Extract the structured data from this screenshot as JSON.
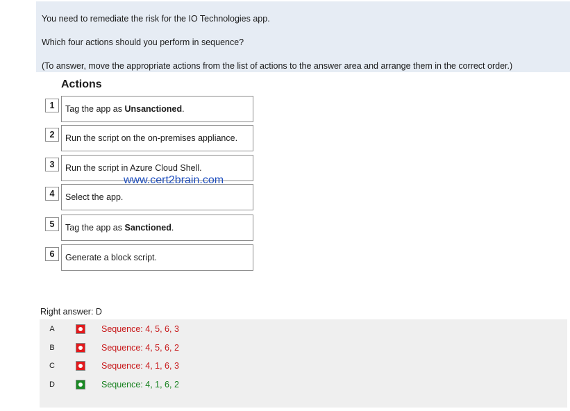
{
  "question": {
    "line1": "You need to remediate the risk for the IO Technologies app.",
    "line2": "Which four actions should you perform in sequence?",
    "line3": "(To answer, move the appropriate actions from the list of actions to the answer area and arrange them in the correct order.)"
  },
  "actions_title": "Actions",
  "actions": [
    {
      "num": "1",
      "pre": "Tag the app as ",
      "bold": "Unsanctioned",
      "post": "."
    },
    {
      "num": "2",
      "pre": "Run the script on the on-premises appliance.",
      "bold": "",
      "post": ""
    },
    {
      "num": "3",
      "pre": "Run the script in Azure Cloud Shell.",
      "bold": "",
      "post": ""
    },
    {
      "num": "4",
      "pre": "Select the app.",
      "bold": "",
      "post": ""
    },
    {
      "num": "5",
      "pre": "Tag the app as ",
      "bold": "Sanctioned",
      "post": "."
    },
    {
      "num": "6",
      "pre": "Generate a block script.",
      "bold": "",
      "post": ""
    }
  ],
  "watermark": "www.cert2brain.com",
  "right_answer": "Right answer: D",
  "options": [
    {
      "letter": "A",
      "text": "Sequence: 4, 5, 6, 3",
      "status": "wrong",
      "color": "#c8191b",
      "icon_color": "#e4191c"
    },
    {
      "letter": "B",
      "text": "Sequence: 4, 5, 6, 2",
      "status": "wrong",
      "color": "#c8191b",
      "icon_color": "#e4191c"
    },
    {
      "letter": "C",
      "text": "Sequence: 4, 1, 6, 3",
      "status": "wrong",
      "color": "#c8191b",
      "icon_color": "#e4191c"
    },
    {
      "letter": "D",
      "text": "Sequence: 4, 1, 6, 2",
      "status": "correct",
      "color": "#16811e",
      "icon_color": "#1a8a24"
    }
  ]
}
